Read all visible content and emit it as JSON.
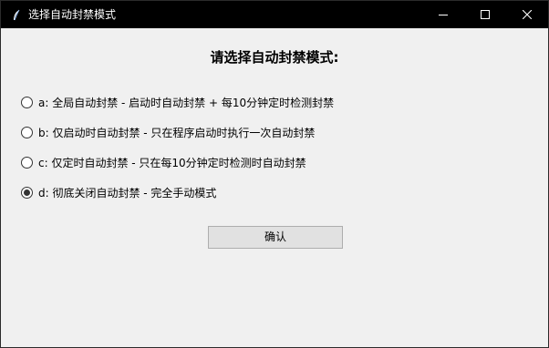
{
  "window": {
    "title": "选择自动封禁模式"
  },
  "main": {
    "heading": "请选择自动封禁模式:",
    "options": [
      {
        "label": "a: 全局自动封禁 - 启动时自动封禁 + 每10分钟定时检测封禁",
        "selected": false
      },
      {
        "label": "b: 仅启动时自动封禁 - 只在程序启动时执行一次自动封禁",
        "selected": false
      },
      {
        "label": "c: 仅定时自动封禁 - 只在每10分钟定时检测时自动封禁",
        "selected": false
      },
      {
        "label": "d: 彻底关闭自动封禁 - 完全手动模式",
        "selected": true
      }
    ],
    "confirm_label": "确认"
  },
  "colors": {
    "titlebar": "#000000",
    "window_bg": "#f0f0f0",
    "button_bg": "#e1e1e1",
    "button_border": "#adadad"
  },
  "icons": [
    "feather-icon",
    "minimize-icon",
    "maximize-icon",
    "close-icon"
  ]
}
